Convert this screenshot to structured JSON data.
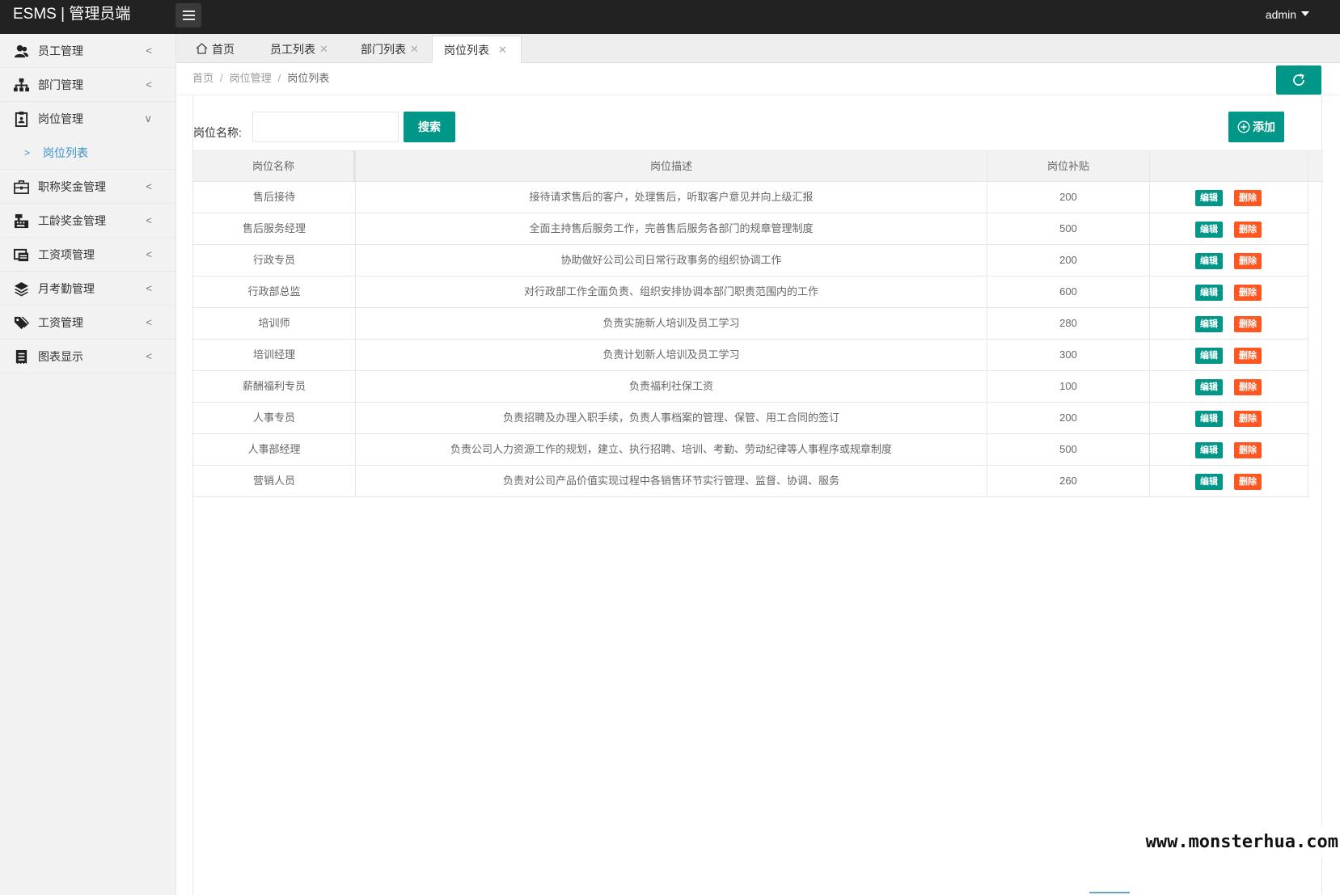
{
  "header": {
    "brand": "ESMS | 管理员端",
    "user": "admin"
  },
  "sidebar": {
    "items": [
      {
        "label": "员工管理",
        "icon": "users-icon"
      },
      {
        "label": "部门管理",
        "icon": "sitemap-icon"
      },
      {
        "label": "岗位管理",
        "icon": "id-card-icon",
        "expanded": true,
        "children": [
          {
            "label": "岗位列表",
            "active": true
          }
        ]
      },
      {
        "label": "职称奖金管理",
        "icon": "briefcase-icon"
      },
      {
        "label": "工龄奖金管理",
        "icon": "cash-register-icon"
      },
      {
        "label": "工资项管理",
        "icon": "cash-list-icon"
      },
      {
        "label": "月考勤管理",
        "icon": "layers-icon"
      },
      {
        "label": "工资管理",
        "icon": "tags-icon"
      },
      {
        "label": "图表显示",
        "icon": "receipt-icon"
      }
    ]
  },
  "tabs": [
    {
      "label": "首页",
      "closable": false
    },
    {
      "label": "员工列表",
      "closable": true
    },
    {
      "label": "部门列表",
      "closable": true
    },
    {
      "label": "岗位列表",
      "closable": true,
      "active": true
    }
  ],
  "tab_close_glyph": "✕",
  "breadcrumb": [
    "首页",
    "岗位管理",
    "岗位列表"
  ],
  "breadcrumb_sep": "/",
  "search": {
    "label": "岗位名称:",
    "value": "",
    "button": "搜索"
  },
  "add_button": "添加",
  "table": {
    "headers": [
      "岗位名称",
      "岗位描述",
      "岗位补贴",
      ""
    ],
    "edit_label": "编辑",
    "delete_label": "删除",
    "rows": [
      {
        "name": "售后接待",
        "desc": "接待请求售后的客户，处理售后，听取客户意见并向上级汇报",
        "pay": "200"
      },
      {
        "name": "售后服务经理",
        "desc": "全面主持售后服务工作，完善售后服务各部门的规章管理制度",
        "pay": "500"
      },
      {
        "name": "行政专员",
        "desc": "协助做好公司公司日常行政事务的组织协调工作",
        "pay": "200"
      },
      {
        "name": "行政部总监",
        "desc": "对行政部工作全面负责、组织安排协调本部门职责范围内的工作",
        "pay": "600"
      },
      {
        "name": "培训师",
        "desc": "负责实施新人培训及员工学习",
        "pay": "280"
      },
      {
        "name": "培训经理",
        "desc": "负责计划新人培训及员工学习",
        "pay": "300"
      },
      {
        "name": "薪酬福利专员",
        "desc": "负责福利社保工资",
        "pay": "100"
      },
      {
        "name": "人事专员",
        "desc": "负责招聘及办理入职手续，负责人事档案的管理、保管、用工合同的签订",
        "pay": "200"
      },
      {
        "name": "人事部经理",
        "desc": "负责公司人力资源工作的规划，建立、执行招聘、培训、考勤、劳动纪律等人事程序或规章制度",
        "pay": "500"
      },
      {
        "name": "营销人员",
        "desc": "负责对公司产品价值实现过程中各销售环节实行管理、监督、协调、服务",
        "pay": "260"
      }
    ]
  },
  "watermark": "www.monsterhua.com",
  "colors": {
    "primary": "#009688",
    "danger": "#ff5722",
    "header_bg": "#222222",
    "sidebar_bg": "#f2f2f2",
    "active_link": "#3a8fc7"
  }
}
